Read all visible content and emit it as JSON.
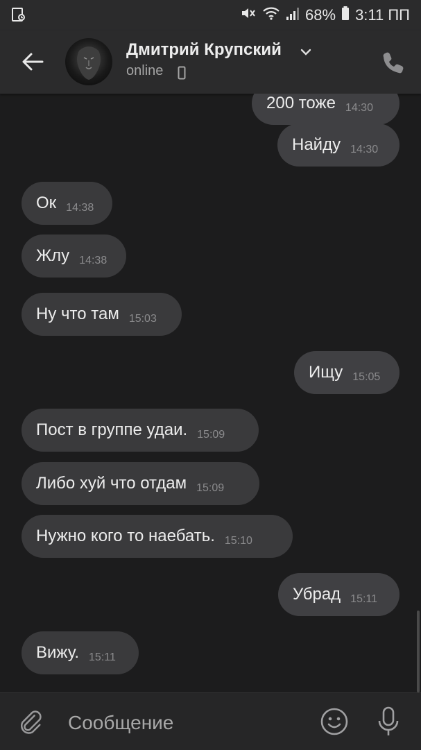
{
  "status_bar": {
    "battery": "68%",
    "time": "3:11 ПП"
  },
  "header": {
    "contact_name": "Дмитрий Крупский",
    "contact_status": "online"
  },
  "messages": [
    {
      "direction": "out",
      "text": "200 тоже",
      "time": "14:30"
    },
    {
      "direction": "out",
      "text": "Найду",
      "time": "14:30"
    },
    {
      "direction": "in",
      "text": "Ок",
      "time": "14:38"
    },
    {
      "direction": "in",
      "text": "Жлу",
      "time": "14:38"
    },
    {
      "direction": "in",
      "text": "Ну что там",
      "time": "15:03"
    },
    {
      "direction": "out",
      "text": "Ищу",
      "time": "15:05"
    },
    {
      "direction": "in",
      "text": "Пост в группе удаи.",
      "time": "15:09"
    },
    {
      "direction": "in",
      "text": "Либо хуй что отдам",
      "time": "15:09"
    },
    {
      "direction": "in",
      "text": "Нужно кого то наебать.",
      "time": "15:10"
    },
    {
      "direction": "out",
      "text": "Убрад",
      "time": "15:11"
    },
    {
      "direction": "in",
      "text": "Вижу.",
      "time": "15:11"
    }
  ],
  "composer": {
    "placeholder": "Сообщение"
  },
  "icons": [
    "screenshot-icon",
    "mute-icon",
    "wifi-icon",
    "signal-icon",
    "battery-icon",
    "back-arrow-icon",
    "chevron-down-icon",
    "mobile-device-icon",
    "phone-call-icon",
    "attach-icon",
    "emoji-icon",
    "microphone-icon"
  ]
}
